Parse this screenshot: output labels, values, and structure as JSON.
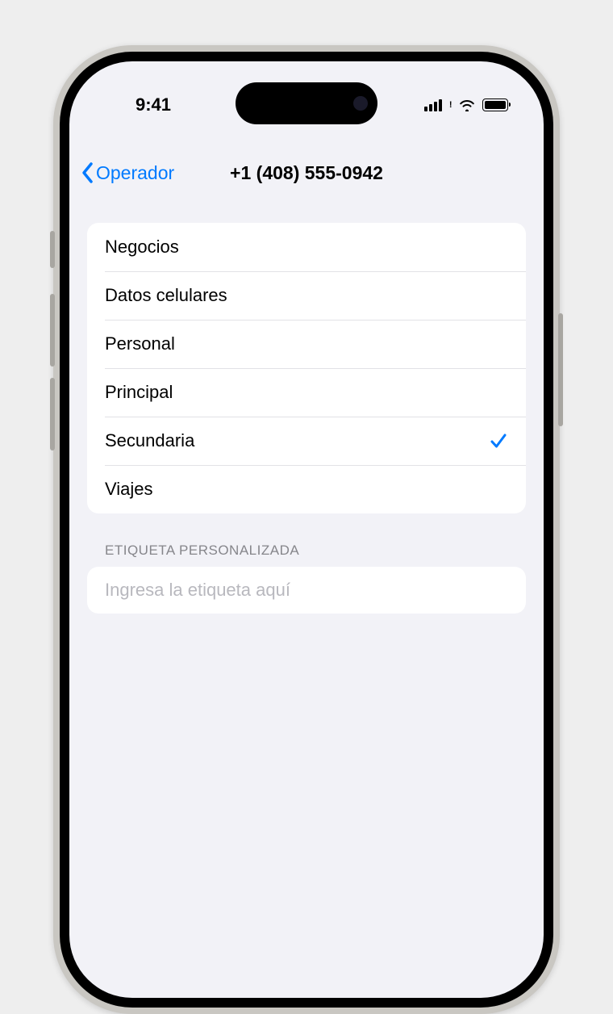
{
  "status": {
    "time": "9:41"
  },
  "nav": {
    "back_label": "Operador",
    "title": "+1 (408) 555-0942"
  },
  "labels": {
    "items": [
      {
        "label": "Negocios",
        "selected": false
      },
      {
        "label": "Datos celulares",
        "selected": false
      },
      {
        "label": "Personal",
        "selected": false
      },
      {
        "label": "Principal",
        "selected": false
      },
      {
        "label": "Secundaria",
        "selected": true
      },
      {
        "label": "Viajes",
        "selected": false
      }
    ]
  },
  "custom": {
    "header": "ETIQUETA PERSONALIZADA",
    "placeholder": "Ingresa la etiqueta aquí",
    "value": ""
  },
  "colors": {
    "accent": "#007aff",
    "background": "#f2f2f7"
  }
}
